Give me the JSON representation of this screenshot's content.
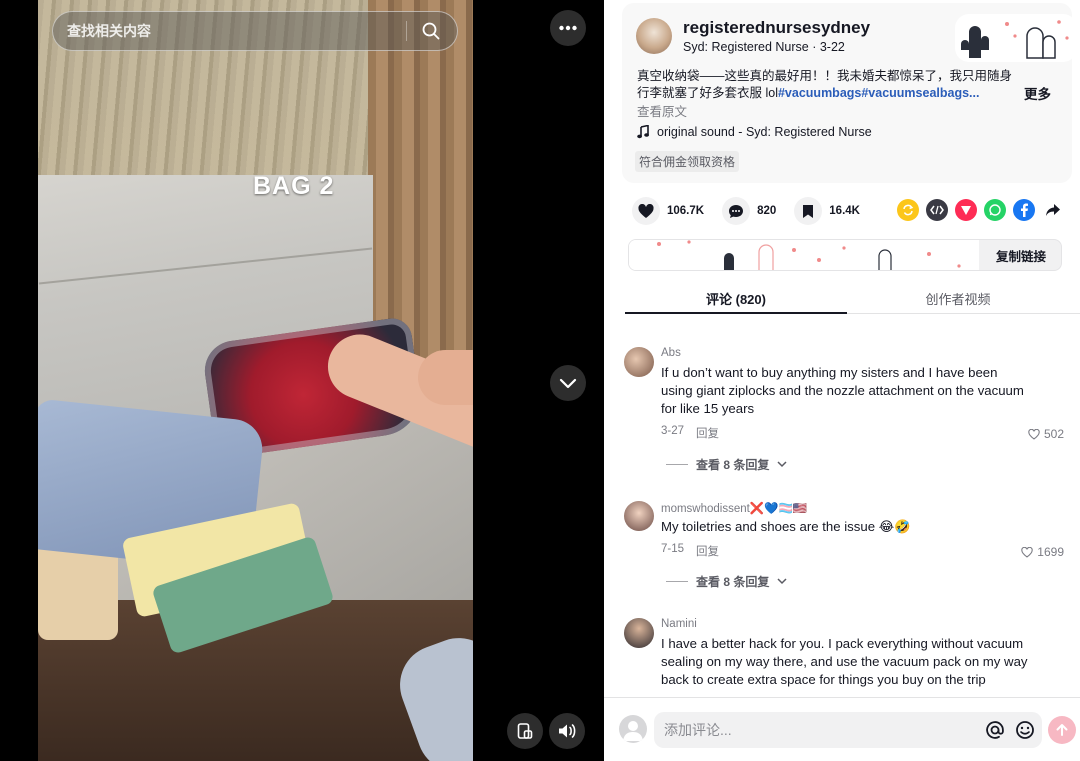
{
  "video": {
    "search_placeholder": "查找相关内容",
    "overlay_text": "BAG 2"
  },
  "post": {
    "username": "registerednursesydney",
    "meta": "Syd: Registered Nurse · 3-22",
    "description_plain": "真空收纳袋——这些真的最好用！！我未婚夫都惊呆了，我只用随身行李就塞了好多套衣服 lol",
    "description_tags": "#vacuumbags#vacuumsealbags...",
    "more_label": "更多",
    "view_original": "查看原文",
    "sound": "original sound - Syd: Registered Nurse",
    "commission_badge": "符合佣金领取资格"
  },
  "actions": {
    "likes": "106.7K",
    "comments": "820",
    "saves": "16.4K"
  },
  "link_bar": {
    "copy_label": "复制链接"
  },
  "tabs": [
    {
      "label": "评论 (820)"
    },
    {
      "label": "创作者视频"
    }
  ],
  "comments": [
    {
      "user": "Abs",
      "text": "If u don’t want to buy anything my sisters and I have been using giant ziplocks and the nozzle attachment on the vacuum for like 15 years",
      "date": "3-27",
      "reply_label": "回复",
      "likes": "502",
      "view_replies": "查看 8 条回复"
    },
    {
      "user": "momswhodissent❌💙🏳️‍⚧️🇺🇸",
      "text": "My toiletries and shoes are the issue 😂🤣",
      "date": "7-15",
      "reply_label": "回复",
      "likes": "1699",
      "view_replies": "查看 8 条回复"
    },
    {
      "user": "Namini",
      "text": "I have a better hack for you. I pack everything without vacuum sealing on my way there, and use the vacuum pack on my way back to create extra space for things you buy on the trip",
      "date": "",
      "reply_label": "",
      "likes": "",
      "view_replies": ""
    }
  ],
  "composer": {
    "placeholder": "添加评论..."
  },
  "colors": {
    "accent_pink": "#fe2c55",
    "tag_blue": "#2b5db9"
  }
}
